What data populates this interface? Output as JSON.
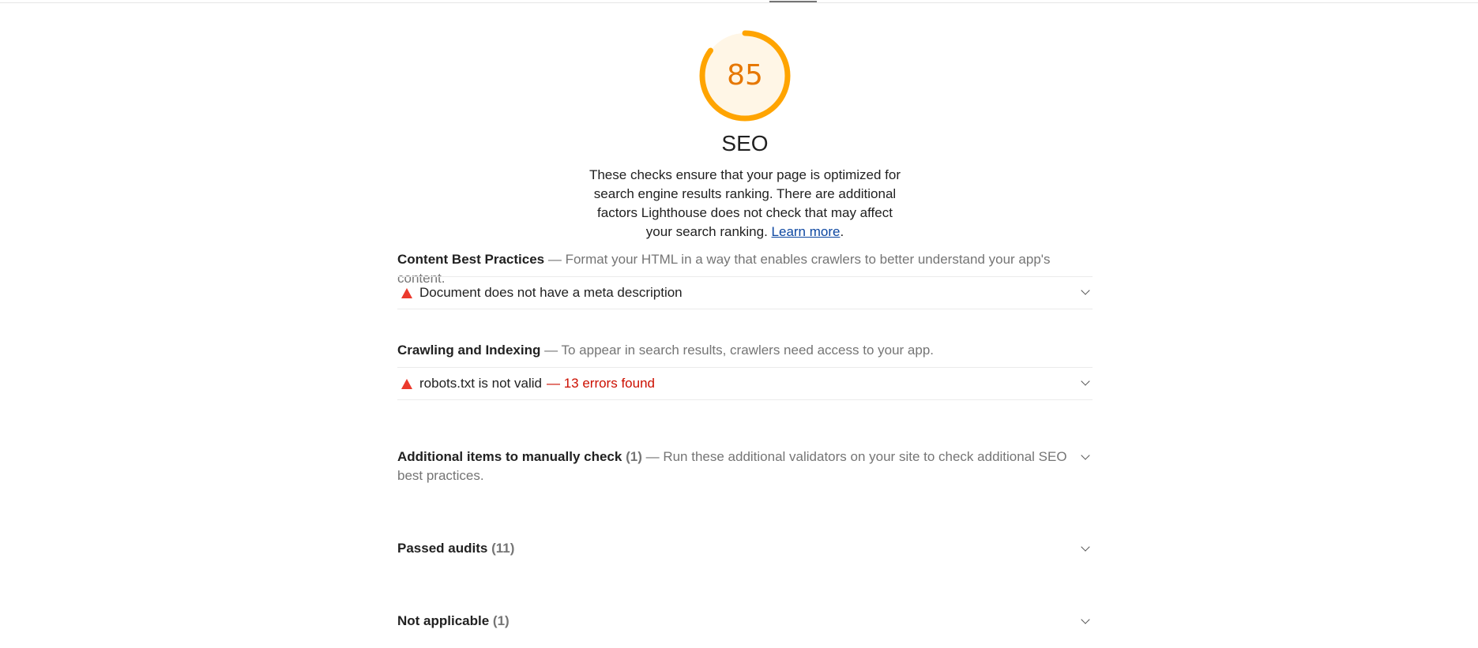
{
  "score": {
    "value": 85,
    "fraction": 0.85,
    "color": "#ffa400"
  },
  "category": {
    "title": "SEO",
    "description": "These checks ensure that your page is optimized for search engine results ranking. There are additional factors Lighthouse does not check that may affect your search ranking. ",
    "learn_more": "Learn more",
    "period": "."
  },
  "groups": [
    {
      "title": "Content Best Practices",
      "description": " — Format your HTML in a way that enables crawlers to better understand your app's content.",
      "audits": [
        {
          "title": "Document does not have a meta description",
          "note": "",
          "status": "fail",
          "icon": "warning-triangle-icon"
        }
      ]
    },
    {
      "title": "Crawling and Indexing",
      "description": " — To appear in search results, crawlers need access to your app.",
      "audits": [
        {
          "title": "robots.txt is not valid",
          "note": "— 13 errors found",
          "status": "fail",
          "icon": "warning-triangle-icon"
        }
      ]
    }
  ],
  "manual": {
    "title": "Additional items to manually check",
    "count": "(1)",
    "description": " — Run these additional validators on your site to check additional SEO best practices."
  },
  "passed": {
    "title": "Passed audits",
    "count": "(11)"
  },
  "not_applicable": {
    "title": "Not applicable",
    "count": "(1)"
  },
  "colors": {
    "fail": "#eb3a2d",
    "fail_text": "#cc0f00",
    "average": "#ffa400",
    "link": "#0d47a1"
  }
}
